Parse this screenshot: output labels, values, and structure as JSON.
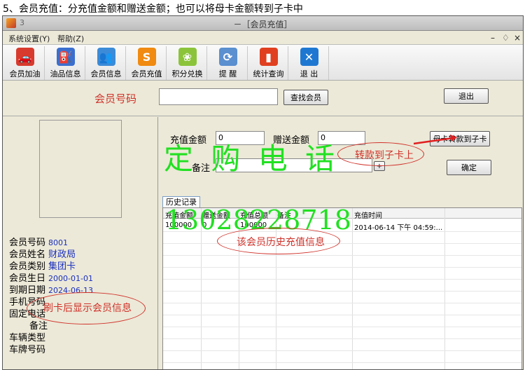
{
  "caption": "5、会员充值：分充值金额和赠送金额；也可以将母卡金额转到子卡中",
  "window": {
    "title": "－［会员充值］",
    "title_glyph": "3"
  },
  "menu": {
    "items": [
      "系统设置(Y)",
      "帮助(Z)"
    ],
    "controls": [
      "–",
      "♢",
      "×"
    ]
  },
  "toolbar": [
    {
      "label": "会员加油",
      "icon": "car-icon",
      "glyph": "🚗",
      "color": "#d83a2e"
    },
    {
      "label": "油品信息",
      "icon": "oil-icon",
      "glyph": "⛽",
      "color": "#3b6fcf"
    },
    {
      "label": "会员信息",
      "icon": "members-icon",
      "glyph": "👥",
      "color": "#3b8bd8"
    },
    {
      "label": "会员充值",
      "icon": "recharge-icon",
      "glyph": "S",
      "color": "#f08a10"
    },
    {
      "label": "积分兑换",
      "icon": "points-icon",
      "glyph": "❀",
      "color": "#8bc43a"
    },
    {
      "label": "提 醒",
      "icon": "reminder-icon",
      "glyph": "⟳",
      "color": "#5a8fd0"
    },
    {
      "label": "统计查询",
      "icon": "stats-icon",
      "glyph": "▮",
      "color": "#e04020"
    },
    {
      "label": "退 出",
      "icon": "exit-icon",
      "glyph": "✕",
      "color": "#1e78d2"
    }
  ],
  "top": {
    "member_no_label": "会员号码",
    "search_button": "查找会员",
    "exit_button": "退出"
  },
  "member": {
    "rows": [
      {
        "label": "会员号码",
        "value": "8001",
        "big": false
      },
      {
        "label": "会员姓名",
        "value": "财政局",
        "big": true
      },
      {
        "label": "会员类别",
        "value": "集团卡",
        "big": true
      },
      {
        "label": "会员生日",
        "value": "2000-01-01",
        "big": false
      },
      {
        "label": "到期日期",
        "value": "2024-06-13",
        "big": false
      },
      {
        "label": "手机号码",
        "value": "",
        "big": false
      },
      {
        "label": "固定电话",
        "value": "",
        "big": false
      },
      {
        "label": "备注",
        "value": "",
        "big": false
      },
      {
        "label": "车辆类型",
        "value": "",
        "big": false
      },
      {
        "label": "车牌号码",
        "value": "",
        "big": false
      }
    ]
  },
  "recharge": {
    "amount_label": "充值金额",
    "amount_value": "0",
    "bonus_label": "赠送金额",
    "bonus_value": "0",
    "remark_label": "备注",
    "remark_plus": "+",
    "transfer_button": "母卡转款到子卡",
    "confirm_button": "确定"
  },
  "history": {
    "tab": "历史记录",
    "columns": [
      "充值金额",
      "赠送金额",
      "充值总额",
      "备注",
      "充值时间"
    ],
    "rows": [
      [
        "100000",
        "0",
        "100000",
        "",
        "2014-06-14 下午 04:59:..."
      ]
    ]
  },
  "annotations": {
    "watermark_title": "定 购 电 话",
    "watermark_phone": "13028228718",
    "transfer_note": "转款到子卡上",
    "history_note": "该会员历史充值信息",
    "swipe_note": "刷卡后显示会员信息"
  },
  "colors": {
    "accent_red": "#d0322a",
    "watermark_green": "#22e022",
    "value_blue": "#1a2fbf"
  }
}
